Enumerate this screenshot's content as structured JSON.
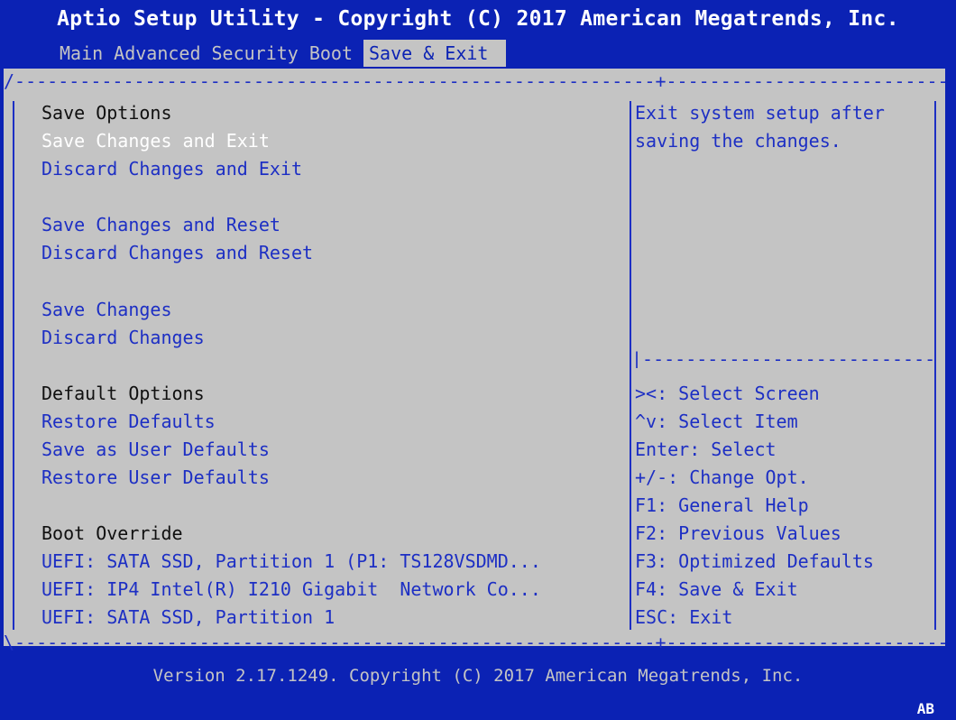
{
  "title": "Aptio Setup Utility - Copyright (C) 2017 American Megatrends, Inc.",
  "tabs": [
    "Main",
    "Advanced",
    "Security",
    "Boot",
    "Save & Exit"
  ],
  "active_tab": "Save & Exit",
  "left": {
    "save_options_header": "Save Options",
    "save_changes_and_exit": "Save Changes and Exit",
    "discard_changes_and_exit": "Discard Changes and Exit",
    "save_changes_and_reset": "Save Changes and Reset",
    "discard_changes_and_reset": "Discard Changes and Reset",
    "save_changes": "Save Changes",
    "discard_changes": "Discard Changes",
    "default_options_header": "Default Options",
    "restore_defaults": "Restore Defaults",
    "save_as_user_defaults": "Save as User Defaults",
    "restore_user_defaults": "Restore User Defaults",
    "boot_override_header": "Boot Override",
    "boot_1": "UEFI: SATA SSD, Partition 1 (P1: TS128VSDMD...",
    "boot_2": "UEFI: IP4 Intel(R) I210 Gigabit  Network Co...",
    "boot_3": "UEFI: SATA SSD, Partition 1"
  },
  "help": {
    "line1": "Exit system setup after",
    "line2": "saving the changes."
  },
  "keys": [
    "><: Select Screen",
    "^v: Select Item",
    "Enter: Select",
    "+/-: Change Opt.",
    "F1: General Help",
    "F2: Previous Values",
    "F3: Optimized Defaults",
    "F4: Save & Exit",
    "ESC: Exit"
  ],
  "footer": "Version 2.17.1249. Copyright (C) 2017 American Megatrends, Inc.",
  "badge": "AB",
  "colors": {
    "background": "#0b22b4",
    "panel": "#c4c4c4",
    "item_text": "#1d2fc4",
    "selected_text": "#ffffff"
  }
}
